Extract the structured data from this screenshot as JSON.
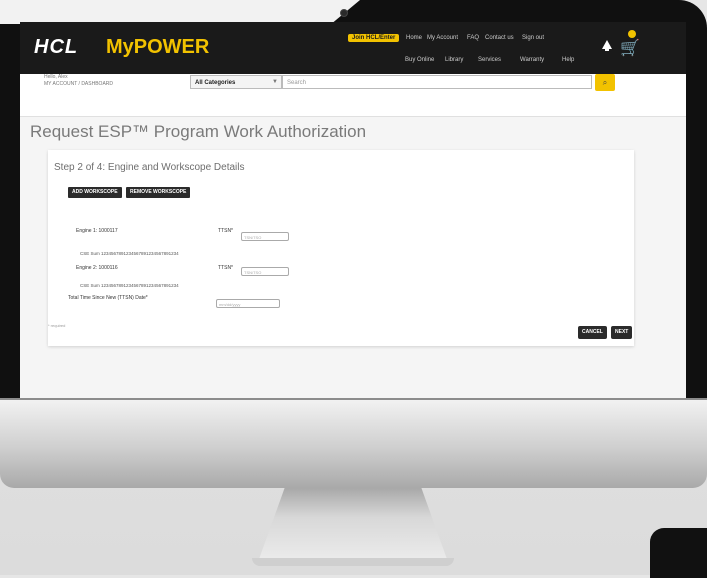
{
  "header": {
    "logo_brand": "HCL",
    "logo_product": "MyPOWER",
    "register_label": "Join HCL/Enter",
    "top_links": [
      "Home",
      "My Account",
      "FAQ",
      "Contact us",
      "Sign out"
    ],
    "nav_links": [
      "Buy Online",
      "Library",
      "Services",
      "Warranty",
      "Help"
    ]
  },
  "account": {
    "line1": "Hello, Alex",
    "line2": "MY ACCOUNT / DASHBOARD"
  },
  "search": {
    "category": "All Categories",
    "placeholder": "Search"
  },
  "page": {
    "title": "Request ESP™ Program Work Authorization",
    "step_title": "Step 2 of 4: Engine and Workscope Details"
  },
  "actions": {
    "add_workscope": "ADD WORKSCOPE",
    "remove_workscope": "REMOVE WORKSCOPE",
    "cancel": "CANCEL",
    "next": "NEXT"
  },
  "engines": [
    {
      "label": "Engine 1: 1000117",
      "tsn_label": "TTSN*",
      "tsn_placeholder": "TSN/TSO",
      "sub_label": "CSE Sum 1234567891234567891234567891234"
    },
    {
      "label": "Engine 2: 1000116",
      "tsn_label": "TTSN*",
      "tsn_placeholder": "TSN/TSO",
      "sub_label": "CSE Sum 1234567891234567891234567891234"
    }
  ],
  "total_hours": {
    "label": "Total Time Since New (TTSN) Date*",
    "placeholder": "mm/dd/yyyy"
  },
  "required_note": "* required"
}
